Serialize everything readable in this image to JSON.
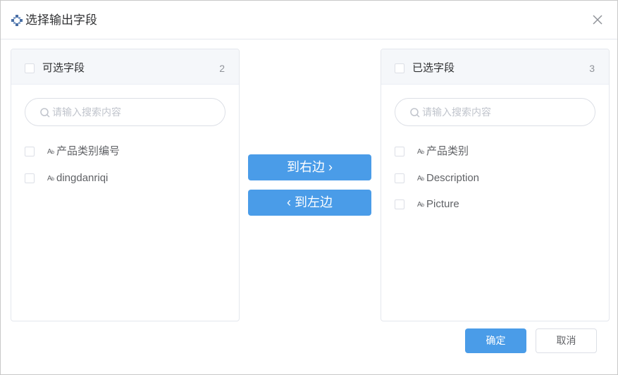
{
  "dialog": {
    "title": "选择输出字段",
    "title_icon": "field-select-icon",
    "close_icon": "close-icon"
  },
  "left_panel": {
    "title": "可选字段",
    "count": "2",
    "search_placeholder": "请输入搜索内容",
    "items": [
      {
        "label": "产品类别编号",
        "type_icon": "Ab"
      },
      {
        "label": "dingdanriqi",
        "type_icon": "Ab"
      }
    ]
  },
  "right_panel": {
    "title": "已选字段",
    "count": "3",
    "search_placeholder": "请输入搜索内容",
    "items": [
      {
        "label": "产品类别",
        "type_icon": "Ab"
      },
      {
        "label": "Description",
        "type_icon": "Ab"
      },
      {
        "label": "Picture",
        "type_icon": "Ab"
      }
    ]
  },
  "transfer": {
    "to_right_label": "到右边",
    "to_left_label": "到左边"
  },
  "footer": {
    "confirm_label": "确定",
    "cancel_label": "取消"
  },
  "colors": {
    "primary": "#4a9ce8",
    "border": "#e4e7ed",
    "header_bg": "#f5f7fa"
  }
}
